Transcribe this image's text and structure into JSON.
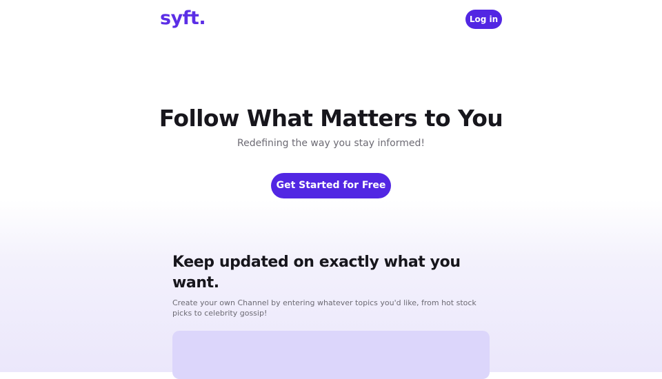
{
  "header": {
    "logo_text": "syft.",
    "login_label": "Log in"
  },
  "hero": {
    "title": "Follow What Matters to You",
    "subtitle": "Redefining the way you stay informed!",
    "cta_label": "Get Started for Free"
  },
  "feature": {
    "title": "Keep updated on exactly what you want.",
    "description": "Create your own Channel by entering whatever topics you'd like, from hot stock picks to celebrity gossip!"
  },
  "colors": {
    "brand": "#5b2ee6",
    "button": "#5227e3",
    "card": "#dcd6fb"
  }
}
